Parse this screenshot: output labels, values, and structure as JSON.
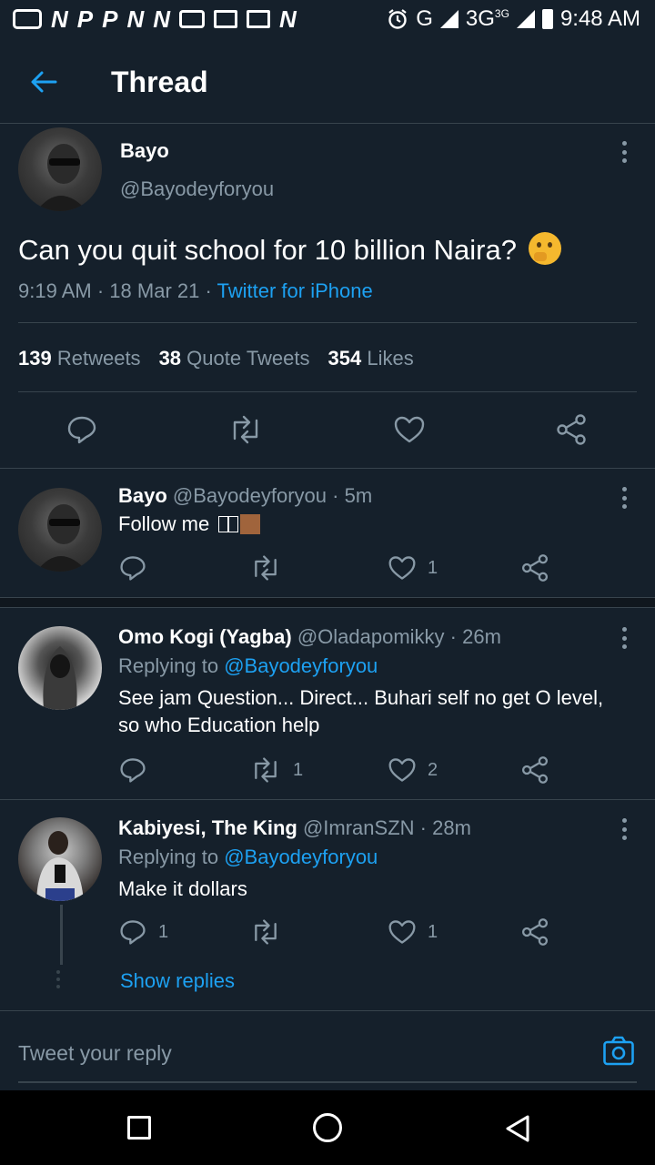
{
  "status_bar": {
    "left_glyphs": [
      "N",
      "P",
      "P",
      "N",
      "N",
      "N"
    ],
    "network": "G",
    "network2": "3G",
    "network2_sup": "3G",
    "time": "9:48 AM"
  },
  "header": {
    "title": "Thread"
  },
  "main_tweet": {
    "name": "Bayo",
    "handle": "@Bayodeyforyou",
    "text": "Can you quit school for 10 billion Naira?",
    "emoji": "🤔",
    "time": "9:19 AM",
    "date": "18 Mar 21",
    "source": "Twitter for iPhone",
    "stats": {
      "retweets_count": "139",
      "retweets_label": "Retweets",
      "quotes_count": "38",
      "quotes_label": "Quote Tweets",
      "likes_count": "354",
      "likes_label": "Likes"
    }
  },
  "replies": [
    {
      "name": "Bayo",
      "handle": "@Bayodeyforyou",
      "age": "5m",
      "replying_label": "",
      "replying_handle": "",
      "text": "Follow me",
      "reply_count": "",
      "retweet_count": "",
      "like_count": "1"
    },
    {
      "name": "Omo Kogi (Yagba)",
      "handle": "@Oladapomikky",
      "age": "26m",
      "replying_label": "Replying to",
      "replying_handle": "@Bayodeyforyou",
      "text_line1": "See jam Question... Direct... Buhari self no get O level,",
      "text_line2": "so who Education help",
      "reply_count": "",
      "retweet_count": "1",
      "like_count": "2"
    },
    {
      "name": "Kabiyesi, The King",
      "handle": "@ImranSZN",
      "age": "28m",
      "replying_label": "Replying to",
      "replying_handle": "@Bayodeyforyou",
      "text": "Make it dollars",
      "reply_count": "1",
      "retweet_count": "",
      "like_count": "1",
      "show_replies": "Show replies"
    }
  ],
  "reply_bar": {
    "placeholder": "Tweet your reply"
  },
  "colors": {
    "background": "#15202b",
    "accent": "#1da1f2",
    "muted": "#8899a6",
    "divider": "#38444d"
  }
}
